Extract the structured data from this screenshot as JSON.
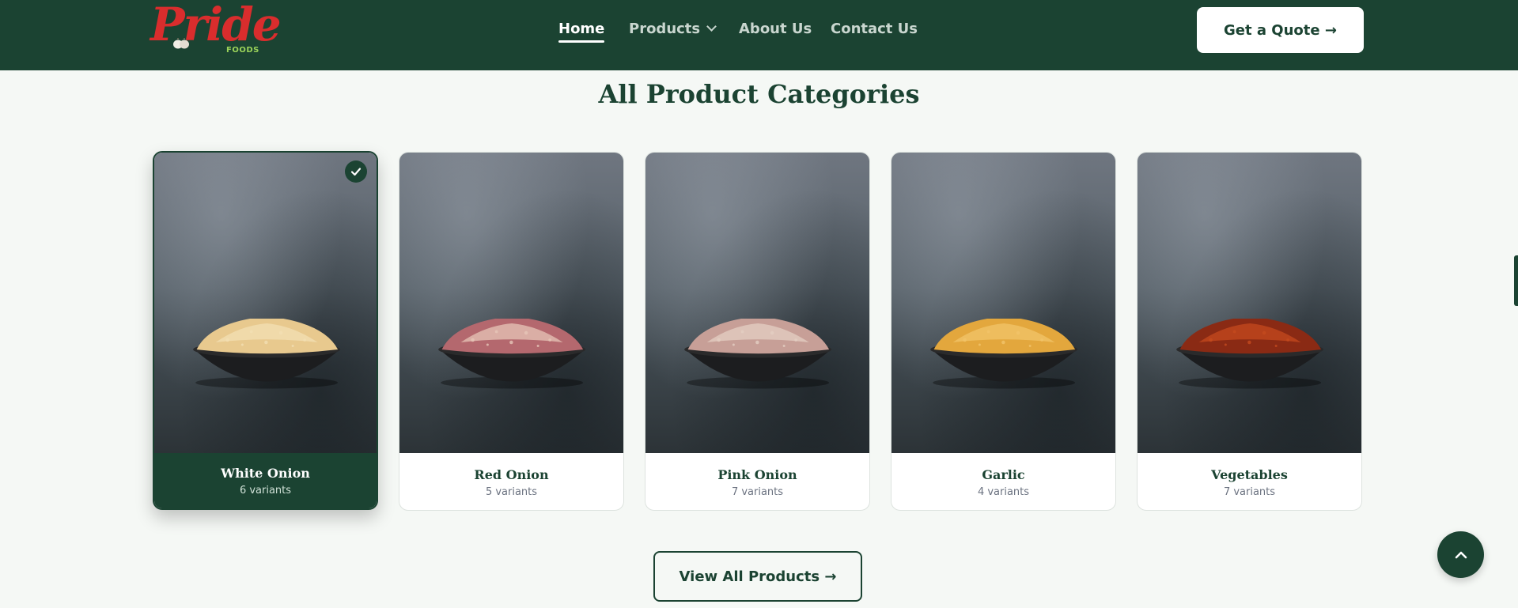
{
  "header": {
    "logo_text": "Pride",
    "logo_sub": "FOODS",
    "nav": [
      {
        "label": "Home",
        "active": true
      },
      {
        "label": "Products",
        "active": false,
        "has_dropdown": true
      },
      {
        "label": "About Us",
        "active": false
      },
      {
        "label": "Contact Us",
        "active": false
      }
    ],
    "cta_label": "Get a Quote →"
  },
  "section": {
    "title": "All Product Categories",
    "categories": [
      {
        "name": "White Onion",
        "variants": "6 variants",
        "selected": true,
        "pile_color": "#e8c98e",
        "pile_accent": "#f3dfb3"
      },
      {
        "name": "Red Onion",
        "variants": "5 variants",
        "selected": false,
        "pile_color": "#b4686e",
        "pile_accent": "#e7c6b8"
      },
      {
        "name": "Pink Onion",
        "variants": "7 variants",
        "selected": false,
        "pile_color": "#c79f97",
        "pile_accent": "#e4cfc3"
      },
      {
        "name": "Garlic",
        "variants": "4 variants",
        "selected": false,
        "pile_color": "#e3a73d",
        "pile_accent": "#f2c46a"
      },
      {
        "name": "Vegetables",
        "variants": "7 variants",
        "selected": false,
        "pile_color": "#8a2a14",
        "pile_accent": "#c44a1e"
      }
    ],
    "view_all_label": "View All Products →"
  },
  "colors": {
    "brand_green": "#1b4332",
    "logo_red": "#d92d2d",
    "page_bg": "#f5f8f5"
  },
  "icons": {
    "nav_dropdown": "chevron-down-icon",
    "selected_badge": "check-icon",
    "scroll_top": "chevron-up-icon"
  }
}
